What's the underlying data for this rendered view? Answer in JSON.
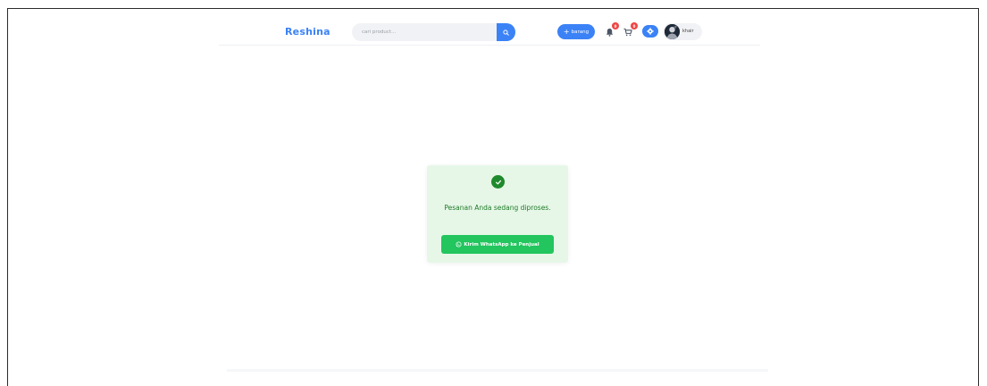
{
  "header": {
    "brand": "Reshina",
    "search": {
      "placeholder": "cari product..."
    },
    "add_button": {
      "icon": "plus-icon",
      "label": "barang"
    },
    "notifications": {
      "icon": "bell-icon",
      "badge": "0"
    },
    "cart": {
      "icon": "cart-icon",
      "badge": "0"
    },
    "settings": {
      "icon": "gear-icon"
    },
    "user": {
      "name": "khair",
      "avatar_icon": "avatar-icon"
    }
  },
  "status_card": {
    "icon": "check-circle-icon",
    "message": "Pesanan Anda sedang diproses.",
    "button": {
      "icon": "whatsapp-icon",
      "label": "Kirim WhatsApp ke Penjual"
    }
  },
  "colors": {
    "accent": "#3b82f6",
    "success_bg": "#e6f7e7",
    "success_text": "#1f7a2a",
    "whatsapp_green": "#22c55e",
    "badge_red": "#ef4444"
  }
}
